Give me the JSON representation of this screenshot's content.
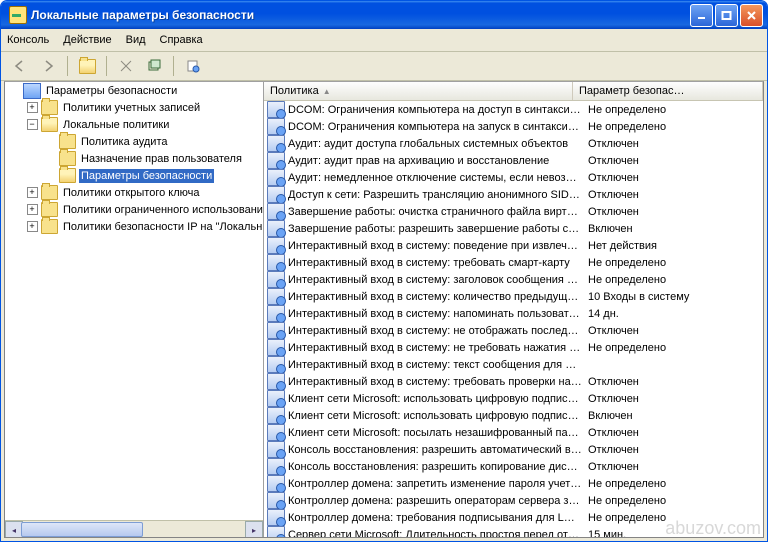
{
  "window": {
    "title": "Локальные параметры безопасности"
  },
  "menu": {
    "items": [
      "Консоль",
      "Действие",
      "Вид",
      "Справка"
    ]
  },
  "tree": {
    "root": "Параметры безопасности",
    "nodes": [
      {
        "label": "Политики учетных записей",
        "level": 1,
        "pm": "+",
        "icon": "closed"
      },
      {
        "label": "Локальные политики",
        "level": 1,
        "pm": "-",
        "icon": "open"
      },
      {
        "label": "Политика аудита",
        "level": 2,
        "pm": "",
        "icon": "closed"
      },
      {
        "label": "Назначение прав пользователя",
        "level": 2,
        "pm": "",
        "icon": "closed"
      },
      {
        "label": "Параметры безопасности",
        "level": 2,
        "pm": "",
        "icon": "open",
        "selected": true
      },
      {
        "label": "Политики открытого ключа",
        "level": 1,
        "pm": "+",
        "icon": "closed"
      },
      {
        "label": "Политики ограниченного использования про…",
        "level": 1,
        "pm": "+",
        "icon": "closed"
      },
      {
        "label": "Политики безопасности IP на \"Локальный ком…",
        "level": 1,
        "pm": "+",
        "icon": "closed"
      }
    ]
  },
  "columns": {
    "c1": "Политика",
    "c2": "Параметр безопас…"
  },
  "policies": [
    {
      "name": "DCOM: Ограничения компьютера на доступ в синтаксисе…",
      "value": "Не определено"
    },
    {
      "name": "DCOM: Ограничения компьютера на запуск в синтаксисе …",
      "value": "Не определено"
    },
    {
      "name": "Аудит: аудит доступа глобальных системных объектов",
      "value": "Отключен"
    },
    {
      "name": "Аудит: аудит прав на архивацию и восстановление",
      "value": "Отключен"
    },
    {
      "name": "Аудит: немедленное отключение системы, если невозмо…",
      "value": "Отключен"
    },
    {
      "name": "Доступ к сети: Разрешить трансляцию анонимного SID в …",
      "value": "Отключен"
    },
    {
      "name": "Завершение работы: очистка страничного файла вирту…",
      "value": "Отключен"
    },
    {
      "name": "Завершение работы: разрешить завершение работы сис…",
      "value": "Включен"
    },
    {
      "name": "Интерактивный вход в систему:  поведение при извлече…",
      "value": "Нет действия"
    },
    {
      "name": "Интерактивный вход в систему:  требовать смарт-карту",
      "value": "Не определено"
    },
    {
      "name": "Интерактивный вход в систему: заголовок сообщения дл…",
      "value": "Не определено"
    },
    {
      "name": "Интерактивный вход в систему: количество предыдущи…",
      "value": "10 Входы в систему"
    },
    {
      "name": "Интерактивный вход в систему: напоминать пользовате…",
      "value": "14 дн."
    },
    {
      "name": "Интерактивный вход в систему: не отображать последн…",
      "value": "Отключен"
    },
    {
      "name": "Интерактивный вход в систему: не требовать нажатия C…",
      "value": "Не определено"
    },
    {
      "name": "Интерактивный вход в систему: текст сообщения для по…",
      "value": ""
    },
    {
      "name": "Интерактивный вход в систему: требовать проверки на …",
      "value": "Отключен"
    },
    {
      "name": "Клиент сети Microsoft: использовать цифровую подпись (…",
      "value": "Отключен"
    },
    {
      "name": "Клиент сети Microsoft: использовать цифровую подпись (…",
      "value": "Включен"
    },
    {
      "name": "Клиент сети Microsoft: посылать незашифрованный паро…",
      "value": "Отключен"
    },
    {
      "name": "Консоль восстановления: разрешить автоматический вх…",
      "value": "Отключен"
    },
    {
      "name": "Консоль восстановления: разрешить копирование диске…",
      "value": "Отключен"
    },
    {
      "name": "Контроллер домена: запретить изменение пароля учетн…",
      "value": "Не определено"
    },
    {
      "name": "Контроллер домена: разрешить операторам сервера зад…",
      "value": "Не определено"
    },
    {
      "name": "Контроллер домена: требования подписывания для LDA…",
      "value": "Не определено"
    },
    {
      "name": "Сервер сети Microsoft: Длительность простоя перед отк…",
      "value": "15 мин."
    }
  ],
  "watermark": "abuzov.com"
}
